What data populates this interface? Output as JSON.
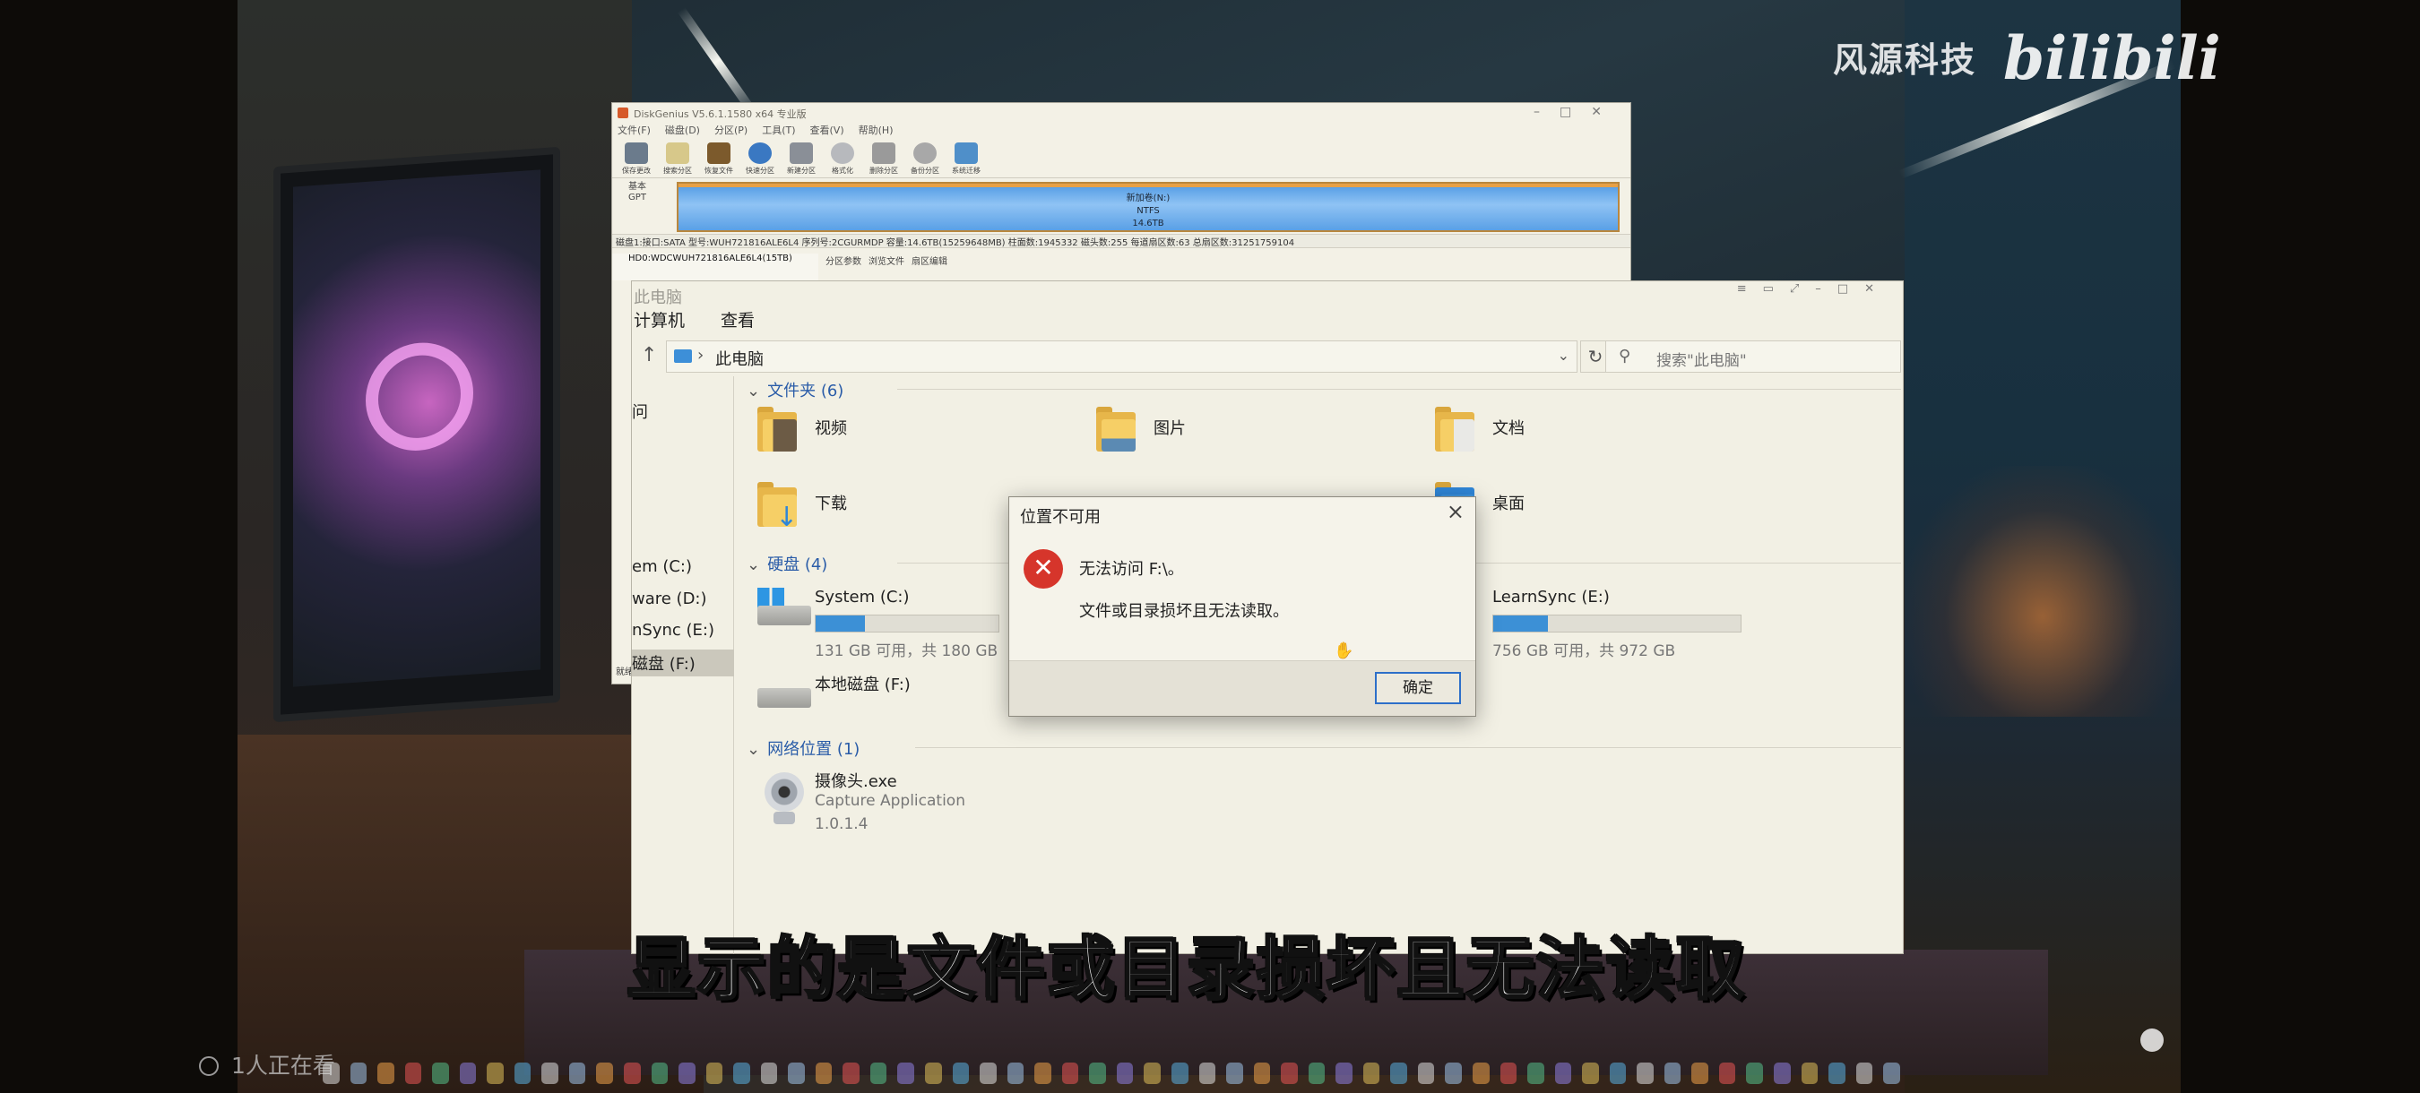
{
  "watermark": {
    "channel": "风源科技",
    "brand": "bilibili"
  },
  "diskgenius": {
    "title": "DiskGenius V5.6.1.1580 x64 专业版",
    "menu": [
      "文件(F)",
      "磁盘(D)",
      "分区(P)",
      "工具(T)",
      "查看(V)",
      "帮助(H)"
    ],
    "tools": [
      "保存更改",
      "搜索分区",
      "恢复文件",
      "快速分区",
      "新建分区",
      "格式化",
      "删除分区",
      "备份分区",
      "系统迁移"
    ],
    "disk_label": "基本\nGPT",
    "partition": {
      "name": "新加卷(N:)",
      "fs": "NTFS",
      "size": "14.6TB"
    },
    "info": "磁盘1:接口:SATA  型号:WUH721816ALE6L4  序列号:2CGURMDP  容量:14.6TB(15259648MB)  柱面数:1945332  磁头数:255  每道扇区数:63  总扇区数:31251759104",
    "tree_item": "HD0:WDCWUH721816ALE6L4(15TB)",
    "tabs": [
      "分区参数",
      "浏览文件",
      "扇区编辑"
    ],
    "status": "就绪"
  },
  "explorer": {
    "title": "此电脑",
    "ribbon": [
      "计算机",
      "查看"
    ],
    "path": "此电脑",
    "search_placeholder": "搜索\"此电脑\"",
    "nav": [
      "问",
      "em (C:)",
      "ware (D:)",
      "nSync (E:)",
      "磁盘 (F:)"
    ],
    "folders_header": "文件夹 (6)",
    "folders": [
      "视频",
      "图片",
      "文档",
      "下载",
      "桌面"
    ],
    "drives_header": "硬盘 (4)",
    "drives": [
      {
        "name": "System (C:)",
        "free": "131 GB 可用，共 180 GB",
        "used_fraction": 0.27
      },
      {
        "name": "LearnSync (E:)",
        "free": "756 GB 可用，共 972 GB",
        "used_fraction": 0.22
      },
      {
        "name": "本地磁盘 (F:)",
        "free": "",
        "used_fraction": 0
      }
    ],
    "network_header": "网络位置 (1)",
    "network": {
      "name": "摄像头.exe",
      "desc": "Capture Application",
      "version": "1.0.1.4"
    }
  },
  "dialog": {
    "title": "位置不可用",
    "line1": "无法访问 F:\\。",
    "line2": "文件或目录损坏且无法读取。",
    "ok": "确定"
  },
  "subtitle": "显示的是文件或目录损坏且无法读取",
  "viewers": "1人正在看",
  "colors": {
    "accent": "#2d6fc9",
    "error": "#d6352b",
    "drive_bar": "#3c90d6"
  }
}
